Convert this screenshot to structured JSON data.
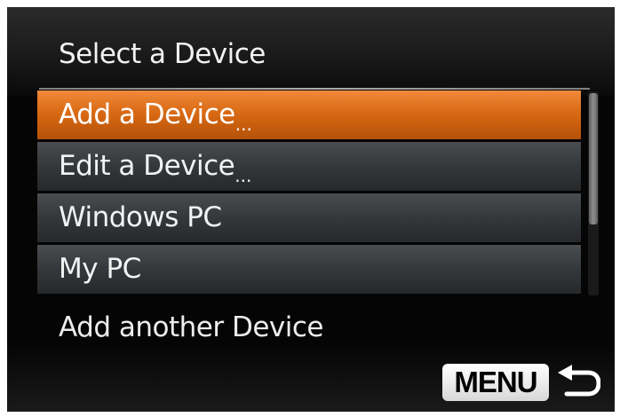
{
  "header": {
    "title": "Select a Device"
  },
  "menu": {
    "items": [
      {
        "label": "Add a Device",
        "suffix": "...",
        "selected": true
      },
      {
        "label": "Edit a Device",
        "suffix": "...",
        "selected": false
      },
      {
        "label": "Windows PC",
        "suffix": "",
        "selected": false
      },
      {
        "label": "My PC",
        "suffix": "",
        "selected": false
      }
    ],
    "next_item": "Add another Device"
  },
  "footer": {
    "menu_button_label": "MENU",
    "back_icon": "return-arrow-icon"
  },
  "colors": {
    "selection": "#d96a14",
    "item_background": "#35383b",
    "screen_background": "#050505"
  }
}
